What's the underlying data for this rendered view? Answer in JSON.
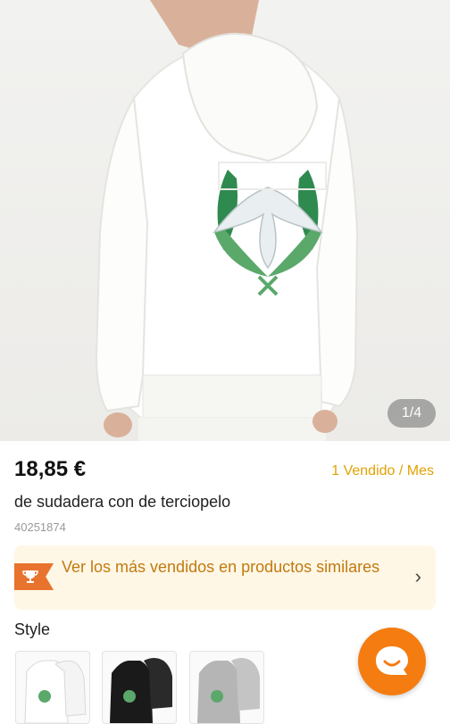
{
  "product": {
    "image_counter": "1/4",
    "price": "18,85 €",
    "sold": "1 Vendido / Mes",
    "title": "de sudadera con de terciopelo",
    "sku": "40251874"
  },
  "promo": {
    "text": "Ver los más vendidos en productos similares",
    "chevron": "›"
  },
  "style": {
    "label": "Style",
    "options": [
      "white",
      "black",
      "gray"
    ]
  },
  "colors": {
    "accent": "#f57c10",
    "sold": "#e0a200",
    "promo_bg": "#fff7e6",
    "promo_text": "#c07a10",
    "promo_badge": "#e8732f"
  },
  "icons": {
    "promo": "trophy-icon",
    "chat": "chat-icon",
    "chevron": "chevron-right-icon"
  }
}
